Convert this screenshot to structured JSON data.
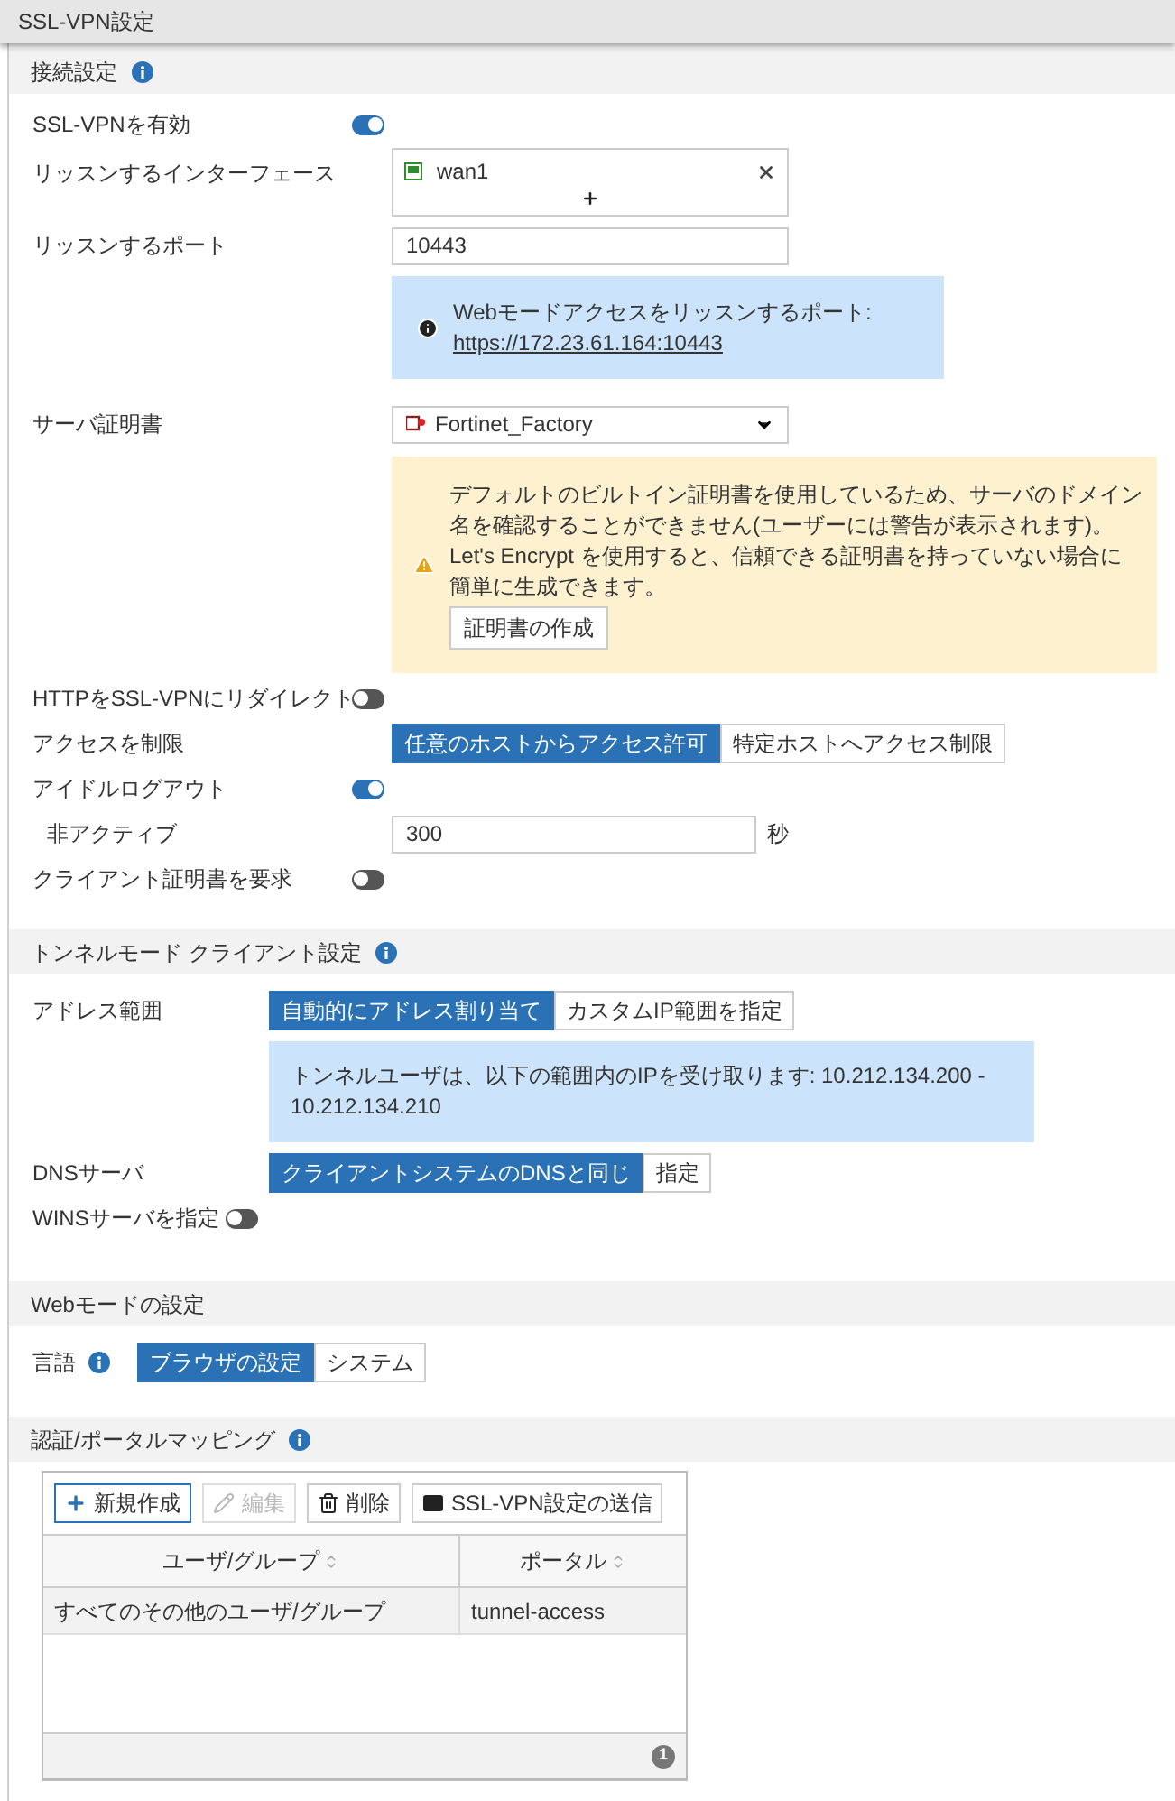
{
  "window": {
    "title": "SSL-VPN設定"
  },
  "sections": [
    {
      "title": "接続設定",
      "info": true,
      "rows": [
        {
          "kind": "toggle",
          "label": "SSL-VPNを有効",
          "on": true
        },
        {
          "kind": "interfaces",
          "label": "リッスンするインターフェース",
          "items": [
            "wan1"
          ]
        },
        {
          "kind": "input",
          "label": "リッスンするポート",
          "value": "10443"
        },
        {
          "kind": "info",
          "text": "Webモードアクセスをリッスンするポート:",
          "link": "https://172.23.61.164:10443"
        },
        {
          "kind": "select",
          "label": "サーバ証明書",
          "value": "Fortinet_Factory"
        },
        {
          "kind": "warning",
          "text": "デフォルトのビルトイン証明書を使用しているため、サーバのドメイン名を確認することができません(ユーザーには警告が表示されます)。Let's Encrypt を使用すると、信頼できる証明書を持っていない場合に簡単に生成できます。",
          "button": "証明書の作成"
        },
        {
          "kind": "toggle",
          "label": "HTTPをSSL-VPNにリダイレクト",
          "on": false
        },
        {
          "kind": "segmented",
          "label": "アクセスを制限",
          "options": [
            {
              "label": "任意のホストからアクセス許可",
              "selected": true
            },
            {
              "label": "特定ホストへアクセス制限",
              "selected": false
            }
          ]
        },
        {
          "kind": "toggle",
          "label": "アイドルログアウト",
          "on": true
        },
        {
          "kind": "subinput",
          "label": "非アクティブ",
          "value": "300",
          "unit": "秒"
        },
        {
          "kind": "toggle",
          "label": "クライアント証明書を要求",
          "on": false
        }
      ]
    },
    {
      "title": "トンネルモード クライアント設定",
      "info": true,
      "rows": [
        {
          "kind": "segmented",
          "label": "アドレス範囲",
          "options": [
            {
              "label": "自動的にアドレス割り当て",
              "selected": true
            },
            {
              "label": "カスタムIP範囲を指定",
              "selected": false
            }
          ]
        },
        {
          "kind": "info",
          "text": "トンネルユーザは、以下の範囲内のIPを受け取ります: 10.212.134.200 - 10.212.134.210"
        },
        {
          "kind": "segmented",
          "label": "DNSサーバ",
          "options": [
            {
              "label": "クライアントシステムのDNSと同じ",
              "selected": true
            },
            {
              "label": "指定",
              "selected": false
            }
          ]
        },
        {
          "kind": "toggle",
          "label": "WINSサーバを指定",
          "on": false
        }
      ]
    },
    {
      "title": "Webモードの設定",
      "info": false,
      "rows": [
        {
          "kind": "segmented",
          "label": "言語",
          "info": true,
          "options": [
            {
              "label": "ブラウザの設定",
              "selected": true
            },
            {
              "label": "システム",
              "selected": false
            }
          ]
        }
      ]
    }
  ],
  "mapping": {
    "title": "認証/ポータルマッピング",
    "info": true,
    "toolbar": [
      {
        "kind": "create",
        "label": "新規作成",
        "disabled": false
      },
      {
        "kind": "edit",
        "label": "編集",
        "disabled": true
      },
      {
        "kind": "delete",
        "label": "削除",
        "disabled": false
      },
      {
        "kind": "send",
        "label": "SSL-VPN設定の送信",
        "disabled": false
      }
    ],
    "columns": [
      "ユーザ/グループ",
      "ポータル"
    ],
    "rows": [
      [
        "すべてのその他のユーザ/グループ",
        "tunnel-access"
      ]
    ],
    "count": "1"
  }
}
